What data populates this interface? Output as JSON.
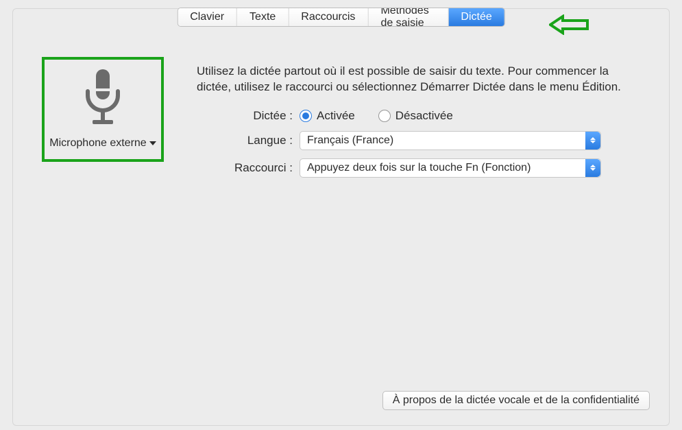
{
  "tabs": {
    "clavier": "Clavier",
    "texte": "Texte",
    "raccourcis": "Raccourcis",
    "methodes": "Méthodes de saisie",
    "dictee": "Dictée"
  },
  "microphone": {
    "label": "Microphone externe"
  },
  "intro": "Utilisez la dictée partout où il est possible de saisir du texte. Pour commencer la dictée, utilisez le raccourci ou sélectionnez Démarrer Dictée dans le menu Édition.",
  "form": {
    "dictation_label": "Dictée :",
    "enabled": "Activée",
    "disabled": "Désactivée",
    "language_label": "Langue :",
    "language_value": "Français (France)",
    "shortcut_label": "Raccourci :",
    "shortcut_value": "Appuyez deux fois sur la touche Fn (Fonction)"
  },
  "footer": {
    "about": "À propos de la dictée vocale et de la confidentialité"
  },
  "annotation": {
    "arrow_color": "#1aa31a"
  }
}
